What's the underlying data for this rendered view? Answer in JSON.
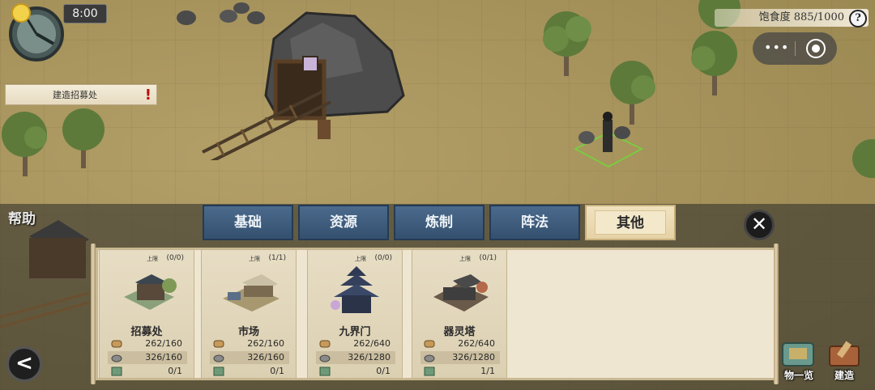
{
  "hud": {
    "time": "8:00",
    "quest_label": "建造招募处",
    "quest_mark": "!",
    "satiety_label": "饱食度",
    "satiety_value": "885/1000",
    "help_q": "?",
    "help_label": "帮助",
    "capsule_more": "•••"
  },
  "tabs": [
    {
      "label": "基础",
      "active": false
    },
    {
      "label": "资源",
      "active": false
    },
    {
      "label": "炼制",
      "active": false
    },
    {
      "label": "阵法",
      "active": false
    },
    {
      "label": "其他",
      "active": true
    }
  ],
  "close_symbol": "✕",
  "back_symbol": "<",
  "cap_label": "上限",
  "buildings": [
    {
      "name": "招募处",
      "limit": "(0/0)",
      "res1": "262/160",
      "res2": "326/160",
      "res3": "0/1"
    },
    {
      "name": "市场",
      "limit": "(1/1)",
      "res1": "262/160",
      "res2": "326/160",
      "res3": "0/1"
    },
    {
      "name": "九界门",
      "limit": "(0/0)",
      "res1": "262/640",
      "res2": "326/1280",
      "res3": "0/1"
    },
    {
      "name": "器灵塔",
      "limit": "(0/1)",
      "res1": "262/640",
      "res2": "326/1280",
      "res3": "1/1"
    }
  ],
  "menu": {
    "overview_label": "物一览",
    "build_label": "建造"
  },
  "colors": {
    "tab_blue": "#3f5d80",
    "tab_active": "#ead8ae",
    "panel": "#efe6d2",
    "quest_mark": "#b81010"
  },
  "icons": [
    "compass-icon",
    "close-icon",
    "back-arrow-icon",
    "help-icon",
    "wood-icon",
    "stone-icon",
    "land-icon"
  ]
}
